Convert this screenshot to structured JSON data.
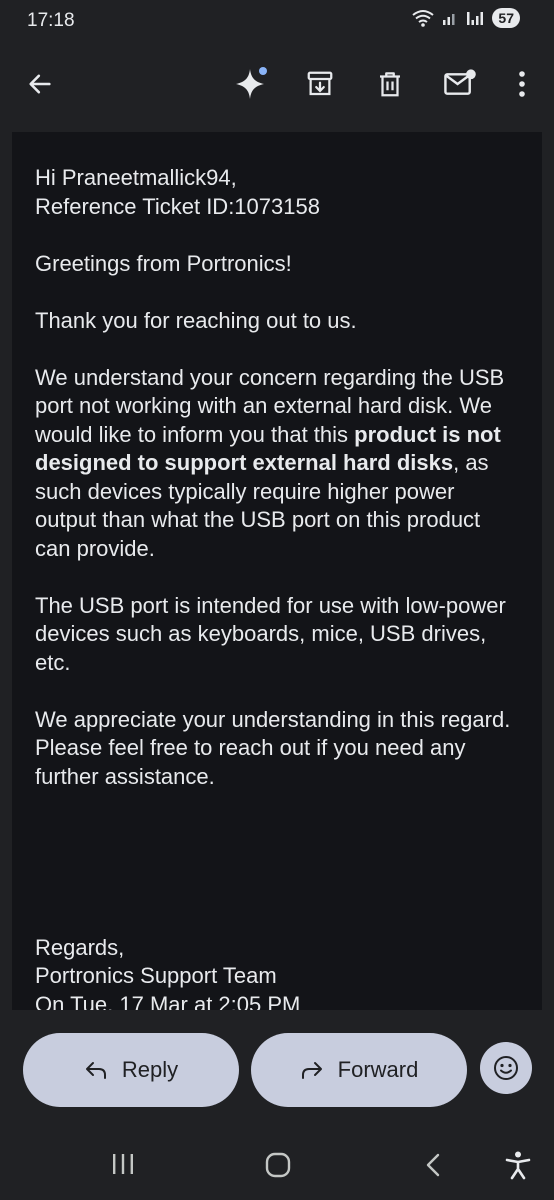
{
  "status": {
    "time": "17:18",
    "battery": "57"
  },
  "toolbar": {
    "back": "back-arrow-icon",
    "ai": "sparkle-icon",
    "archive": "archive-icon",
    "delete": "trash-icon",
    "unread": "mark-unread-icon",
    "more": "more-vert-icon"
  },
  "email": {
    "greeting": "Hi Praneetmallick94,",
    "ticket": "Reference Ticket ID:1073158",
    "greetings": "Greetings from Portronics!",
    "thanks": "Thank you for reaching out to us.",
    "para1_a": "We understand your concern regarding the USB port not working with an external hard disk. We would like to inform you that this ",
    "para1_bold": "product is not designed to support external hard disks",
    "para1_b": ", as such devices typically require higher power output than what the USB port on this product can provide.",
    "para2": "The USB port is intended for use with low-power devices such as keyboards, mice, USB drives, etc.",
    "para3": "We appreciate your understanding in this regard. Please feel free to reach out if you need any further assistance.",
    "regards": "Regards,",
    "team": "Portronics Support Team",
    "quoted": "On Tue, 17 Mar at 2:05 PM"
  },
  "actions": {
    "reply": "Reply",
    "forward": "Forward"
  },
  "colors": {
    "background": "#202124",
    "content": "#131418",
    "pill": "#c8cdde",
    "accent": "#8ab4f8"
  }
}
